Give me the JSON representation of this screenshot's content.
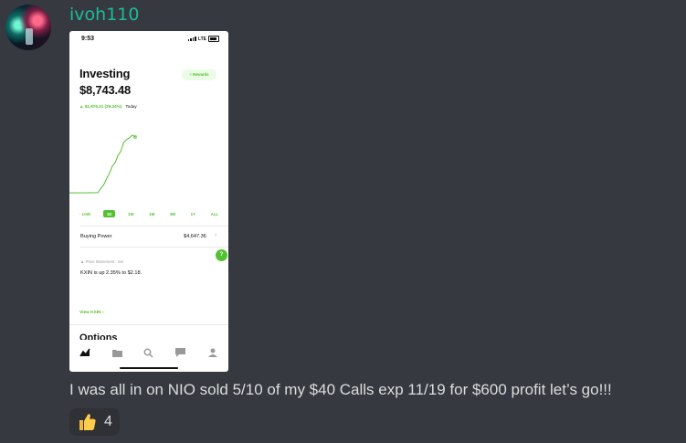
{
  "author": {
    "name": "ivoh110"
  },
  "screenshot": {
    "status_bar": {
      "time": "9:53",
      "network": "LTE"
    },
    "header": {
      "title": "Investing",
      "balance": "$8,743.48",
      "rewards_label": "Rewards"
    },
    "daily_change": {
      "value": "$1,976.31 (29.24%)",
      "period": "Today"
    },
    "chart_data": {
      "type": "line",
      "series": [
        {
          "values": [
            3,
            3,
            3,
            3,
            3,
            3,
            3,
            3.2,
            3.1,
            3.2,
            3.3,
            8,
            12,
            19,
            25,
            33,
            37,
            45,
            50,
            60,
            63,
            65,
            68,
            66
          ]
        }
      ],
      "title": "",
      "xlabel": "",
      "ylabel": "",
      "grid": false
    },
    "timeframes": [
      {
        "label": "· LIVE"
      },
      {
        "label": "1D"
      },
      {
        "label": "1W"
      },
      {
        "label": "1M"
      },
      {
        "label": "3M"
      },
      {
        "label": "1Y"
      },
      {
        "label": "ALL"
      }
    ],
    "selected_timeframe": "1D",
    "buying_power": {
      "label": "Buying Power",
      "value": "$4,647.36"
    },
    "badge_label": "?",
    "price_movement": {
      "label": "Price Movement · 5m",
      "text": "KXIN is up 2.35% to $2.18.",
      "link": "View KXIN"
    },
    "options_heading": "Options"
  },
  "message": {
    "text": "I was all in on NIO sold 5/10 of my $40 Calls exp 11/19 for $600 profit let’s go!!!"
  },
  "reaction": {
    "emoji": "thumbs-up",
    "count": "4"
  },
  "colors": {
    "background": "#36393f",
    "username": "#1abc9c",
    "message_text": "#dcddde",
    "robinhood_green": "#53c230",
    "reaction_bg": "#2f3136"
  }
}
